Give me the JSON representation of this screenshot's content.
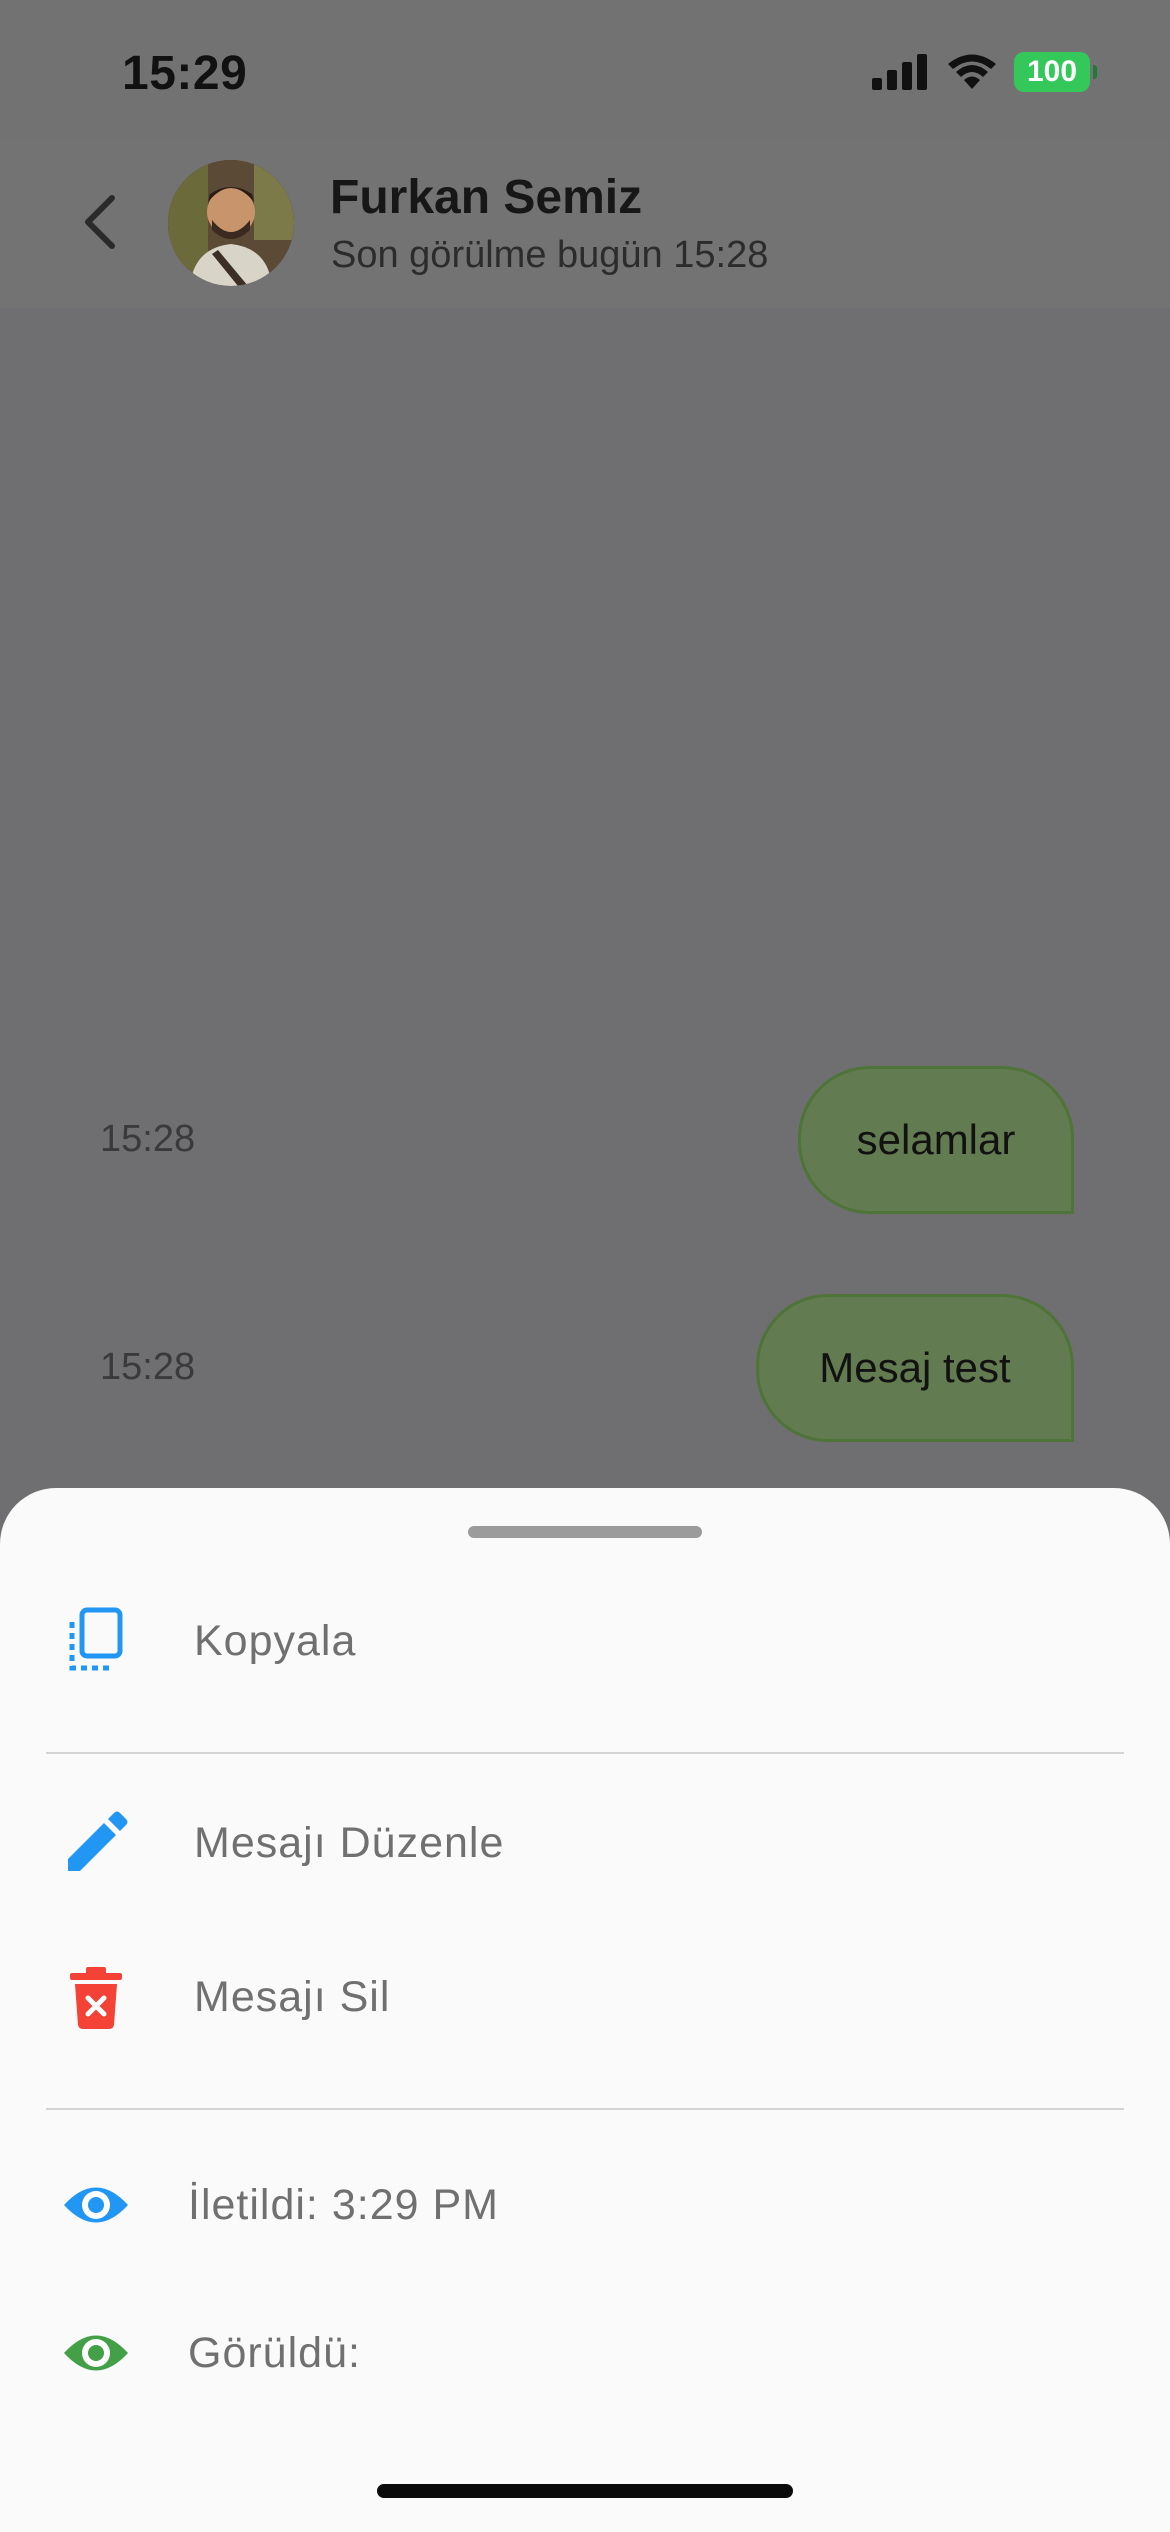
{
  "status_bar": {
    "time": "15:29",
    "battery": "100"
  },
  "header": {
    "name": "Furkan Semiz",
    "status": "Son görülme bugün 15:28"
  },
  "messages": [
    {
      "text": "selamlar",
      "time": "15:28"
    },
    {
      "text": "Mesaj test",
      "time": "15:28"
    }
  ],
  "sheet": {
    "copy_label": "Kopyala",
    "edit_label": "Mesajı Düzenle",
    "delete_label": "Mesajı Sil",
    "delivered_label": "İletildi: 3:29 PM",
    "seen_label": "Görüldü:"
  },
  "colors": {
    "accent_blue": "#2196f3",
    "delete_red": "#f44336",
    "seen_green": "#43a047",
    "bubble_green": "#627b50",
    "battery_green": "#34c759"
  },
  "icons": {
    "back": "chevron-left-icon",
    "copy": "copy-icon",
    "edit": "pencil-icon",
    "delete": "trash-icon",
    "delivered": "eye-icon",
    "seen": "eye-icon"
  }
}
